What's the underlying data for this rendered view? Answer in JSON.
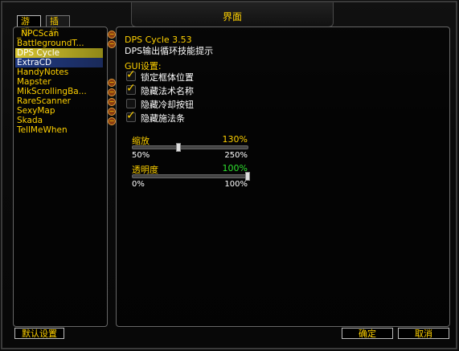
{
  "window": {
    "title": "界面"
  },
  "tabs": [
    {
      "label": "游戏",
      "active": true
    },
    {
      "label": "插件",
      "active": false
    }
  ],
  "addon_list": [
    {
      "label": "_NPCScan",
      "expandable": true,
      "state": "normal"
    },
    {
      "label": "BattlegroundT...",
      "expandable": true,
      "state": "normal"
    },
    {
      "label": "DPS Cycle",
      "expandable": false,
      "state": "selected"
    },
    {
      "label": "ExtraCD",
      "expandable": false,
      "state": "highlight"
    },
    {
      "label": "HandyNotes",
      "expandable": false,
      "state": "normal"
    },
    {
      "label": "Mapster",
      "expandable": true,
      "state": "normal"
    },
    {
      "label": "MikScrollingBa...",
      "expandable": true,
      "state": "normal"
    },
    {
      "label": "RareScanner",
      "expandable": true,
      "state": "normal"
    },
    {
      "label": "SexyMap",
      "expandable": true,
      "state": "normal"
    },
    {
      "label": "Skada",
      "expandable": true,
      "state": "normal"
    },
    {
      "label": "TellMeWhen",
      "expandable": false,
      "state": "normal"
    }
  ],
  "addon": {
    "title": "DPS Cycle 3.53",
    "subtitle": "DPS输出循环技能提示"
  },
  "gui_section": {
    "label": "GUI设置:"
  },
  "options": [
    {
      "label": "锁定框体位置",
      "checked": true
    },
    {
      "label": "隐藏法术名称",
      "checked": true
    },
    {
      "label": "隐藏冷却按钮",
      "checked": false
    },
    {
      "label": "隐藏施法条",
      "checked": true
    }
  ],
  "sliders": [
    {
      "label": "缩放",
      "value_text": "130%",
      "value": 130,
      "min": 50,
      "max": 250,
      "min_label": "50%",
      "max_label": "250%",
      "value_color": "#ffd100"
    },
    {
      "label": "透明度",
      "value_text": "100%",
      "value": 100,
      "min": 0,
      "max": 100,
      "min_label": "0%",
      "max_label": "100%",
      "value_color": "#2fe22f"
    }
  ],
  "buttons": {
    "defaults": "默认设置",
    "ok": "确定",
    "cancel": "取消"
  },
  "colors": {
    "accent": "#ffd100",
    "white": "#ffffff",
    "green": "#2fe22f"
  }
}
